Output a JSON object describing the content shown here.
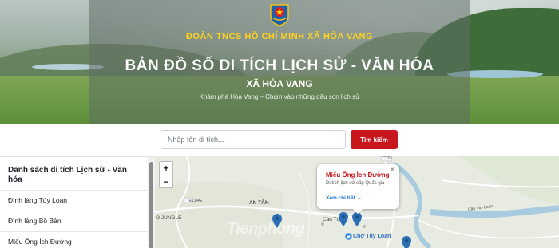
{
  "hero": {
    "org_name": "ĐOÀN TNCS HỒ CHÍ MINH XÃ HÒA VANG",
    "main_title": "BẢN ĐỒ SỐ DI TÍCH LỊCH SỬ - VĂN HÓA",
    "sub_title": "XÃ HÒA VANG",
    "tagline": "Khám phá Hòa Vang – Chạm vào những dấu son lịch sử",
    "emblem_icon": "youth-union-emblem-icon"
  },
  "search": {
    "placeholder": "Nhập tên di tích...",
    "button_label": "Tìm kiếm",
    "button_color": "#c8161d"
  },
  "sidebar": {
    "title": "Danh sách di tích Lịch sử - Văn hóa",
    "items": [
      {
        "label": "Đình làng Túy Loan"
      },
      {
        "label": "Đình làng Bồ Bản"
      },
      {
        "label": "Miếu Ông Ích Đường"
      }
    ]
  },
  "map": {
    "zoom_in": "+",
    "zoom_out": "−",
    "labels": {
      "an_tan": "AN TÂN",
      "jungle": "O JUNGLE",
      "cau_tuy": "Cầu Túy",
      "cho_tuy_loan": "Chợ Túy Loan",
      "cau_tuy_loan": "Cầu Túy Loan",
      "route_ct01": "CT01",
      "route_dl14g": "ĐL14G"
    },
    "watermark": "Tienphong",
    "popup": {
      "title": "Miếu Ông Ích Đường",
      "description": "Di tích lịch sử cấp Quốc gia",
      "link": "Xem chi tiết →",
      "close": "×",
      "title_color": "#c8161d",
      "link_color": "#1a6fd1"
    },
    "marker_color": "#2c6fb7"
  }
}
